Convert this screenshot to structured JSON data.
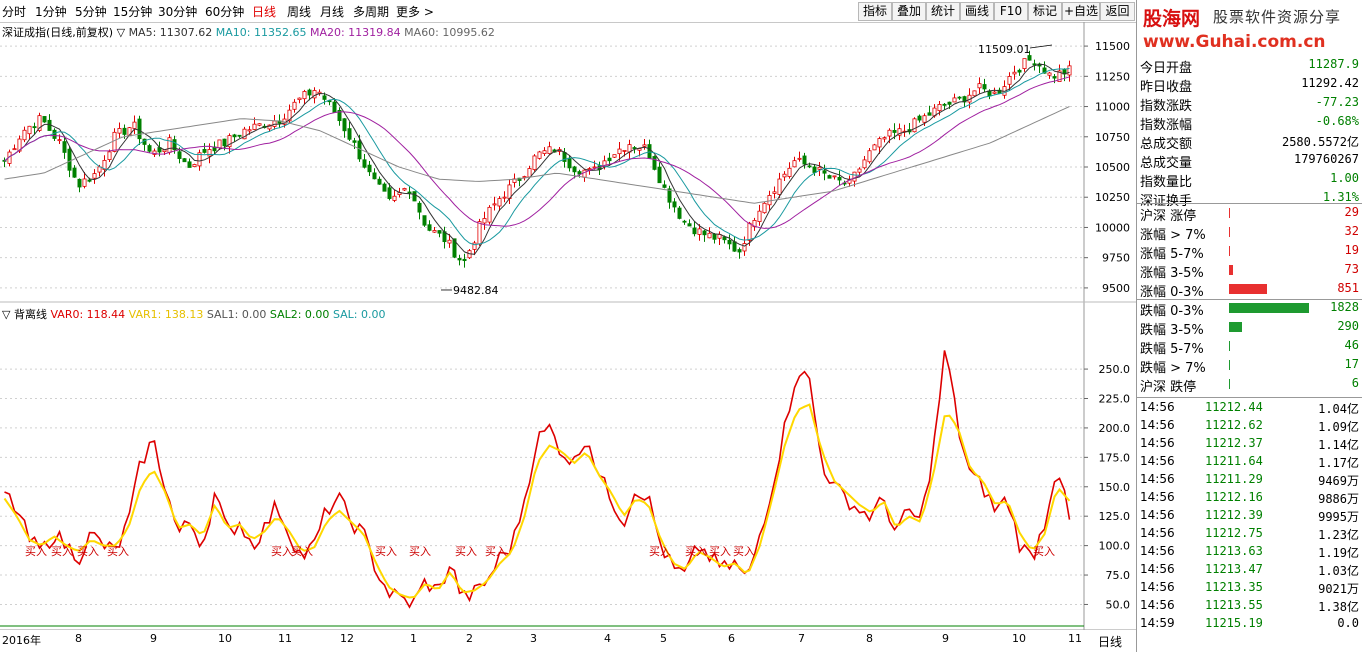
{
  "toolbar": {
    "periods": [
      "分时",
      "1分钟",
      "5分钟",
      "15分钟",
      "30分钟",
      "60分钟",
      "日线",
      "周线",
      "月线",
      "多周期",
      "更多 >"
    ],
    "active_period": "日线",
    "tools": [
      "指标",
      "叠加",
      "统计",
      "画线",
      "F10",
      "标记",
      "+自选",
      "返回"
    ]
  },
  "main_legend": {
    "name": "深证成指(日线,前复权)",
    "ma5": "MA5: 11307.62",
    "ma10": "MA10: 11352.65",
    "ma20": "MA20: 11319.84",
    "ma60": "MA60: 10995.62",
    "colors": {
      "ma5": "#333333",
      "ma10": "#1a9aa0",
      "ma20": "#a020a0",
      "ma60": "#777777"
    }
  },
  "main_axis": [
    "11500",
    "11250",
    "11000",
    "10750",
    "10500",
    "10250",
    "10000",
    "9750",
    "9500"
  ],
  "annotations": {
    "high": "11509.01",
    "low": "9482.84"
  },
  "indicator_legend": {
    "name": "背离线",
    "var0": "VAR0: 118.44",
    "var1": "VAR1: 138.13",
    "sal1": "SAL1: 0.00",
    "sal2": "SAL2: 0.00",
    "sal": "SAL: 0.00"
  },
  "indicator_axis": [
    "250.0",
    "225.0",
    "200.0",
    "175.0",
    "150.0",
    "125.0",
    "100.0",
    "75.0",
    "50.0"
  ],
  "buy_label": "买入",
  "months": [
    "2016年",
    "8",
    "9",
    "10",
    "11",
    "12",
    "1",
    "2",
    "3",
    "4",
    "5",
    "6",
    "7",
    "8",
    "9",
    "10",
    "11"
  ],
  "bottom_right": "日线",
  "banner": {
    "brand": "股海网",
    "slogan": "股票软件资源分享",
    "url": "www.Guhai.com.cn"
  },
  "stats": [
    {
      "label": "今日开盘",
      "value": "11287.9",
      "color": "green"
    },
    {
      "label": "昨日收盘",
      "value": "11292.42",
      "color": "black"
    },
    {
      "label": "指数涨跌",
      "value": "-77.23",
      "color": "green"
    },
    {
      "label": "指数涨幅",
      "value": "-0.68%",
      "color": "green"
    },
    {
      "label": "总成交额",
      "value": "2580.5572亿",
      "color": "black"
    },
    {
      "label": "总成交量",
      "value": "179760267",
      "color": "black"
    },
    {
      "label": "指数量比",
      "value": "1.00",
      "color": "green"
    },
    {
      "label": "深证换手",
      "value": "1.31%",
      "color": "green"
    }
  ],
  "breadth": [
    {
      "label": "沪深 涨停",
      "value": "29",
      "color": "red",
      "bar": 0
    },
    {
      "label": "涨幅 > 7%",
      "value": "32",
      "color": "red",
      "bar": 0
    },
    {
      "label": "涨幅 5-7%",
      "value": "19",
      "color": "red",
      "bar": 0
    },
    {
      "label": "涨幅 3-5%",
      "value": "73",
      "color": "red",
      "bar": 4
    },
    {
      "label": "涨幅 0-3%",
      "value": "851",
      "color": "red",
      "bar": 38
    },
    {
      "label": "跌幅 0-3%",
      "value": "1828",
      "color": "green",
      "bar": 80
    },
    {
      "label": "跌幅 3-5%",
      "value": "290",
      "color": "green",
      "bar": 13
    },
    {
      "label": "跌幅 5-7%",
      "value": "46",
      "color": "green",
      "bar": 0
    },
    {
      "label": "跌幅 > 7%",
      "value": "17",
      "color": "green",
      "bar": 0
    },
    {
      "label": "沪深 跌停",
      "value": "6",
      "color": "green",
      "bar": 0
    }
  ],
  "ticks": [
    {
      "time": "14:56",
      "price": "11212.44",
      "vol": "1.04亿"
    },
    {
      "time": "14:56",
      "price": "11212.62",
      "vol": "1.09亿"
    },
    {
      "time": "14:56",
      "price": "11212.37",
      "vol": "1.14亿"
    },
    {
      "time": "14:56",
      "price": "11211.64",
      "vol": "1.17亿"
    },
    {
      "time": "14:56",
      "price": "11211.29",
      "vol": "9469万"
    },
    {
      "time": "14:56",
      "price": "11212.16",
      "vol": "9886万"
    },
    {
      "time": "14:56",
      "price": "11212.39",
      "vol": "9995万"
    },
    {
      "time": "14:56",
      "price": "11212.75",
      "vol": "1.23亿"
    },
    {
      "time": "14:56",
      "price": "11213.63",
      "vol": "1.19亿"
    },
    {
      "time": "14:56",
      "price": "11213.47",
      "vol": "1.03亿"
    },
    {
      "time": "14:56",
      "price": "11213.35",
      "vol": "9021万"
    },
    {
      "time": "14:56",
      "price": "11213.55",
      "vol": "1.38亿"
    },
    {
      "time": "14:59",
      "price": "11215.19",
      "vol": "0.0"
    }
  ],
  "chart_data": {
    "type": "line",
    "main": {
      "name": "深证成指(日线,前复权)",
      "y_range": [
        9400,
        11600
      ],
      "x_months": [
        "2016年",
        "8",
        "9",
        "10",
        "11",
        "12",
        "1",
        "2",
        "3",
        "4",
        "5",
        "6",
        "7",
        "8",
        "9",
        "10",
        "11"
      ],
      "close_path": [
        10550,
        10800,
        10900,
        10700,
        10350,
        10450,
        10750,
        10850,
        10600,
        10700,
        10500,
        10650,
        10700,
        10800,
        10850,
        10900,
        11050,
        11150,
        10950,
        10700,
        10400,
        10200,
        10350,
        10000,
        9900,
        9700,
        10050,
        10250,
        10400,
        10600,
        10650,
        10500,
        10450,
        10600,
        10700,
        10650,
        10300,
        10050,
        9950,
        9900,
        9800,
        10150,
        10350,
        10550,
        10500,
        10400,
        10350,
        10600,
        10750,
        10800,
        10900,
        11000,
        11050,
        11150,
        11100,
        11300,
        11400,
        11250,
        11300
      ],
      "ma60_path": [
        10400,
        10450,
        10600,
        10750,
        10800,
        10850,
        10900,
        10880,
        10800,
        10650,
        10500,
        10400,
        10380,
        10400,
        10450,
        10400,
        10350,
        10300,
        10250,
        10200,
        10250,
        10300,
        10400,
        10500,
        10600,
        10700,
        10850,
        11000
      ],
      "high": 11509.01,
      "low": 9482.84
    },
    "indicator": {
      "name": "背离线",
      "y_range": [
        30,
        290
      ],
      "series": [
        {
          "name": "VAR0",
          "color": "#dd0000",
          "values": [
            145,
            130,
            105,
            95,
            110,
            100,
            90,
            110,
            100,
            95,
            120,
            170,
            190,
            150,
            110,
            120,
            100,
            145,
            110,
            120,
            100,
            115,
            135,
            110,
            90,
            100,
            130,
            140,
            120,
            110,
            80,
            60,
            55,
            50,
            70,
            60,
            85,
            55,
            60,
            70,
            90,
            100,
            140,
            190,
            200,
            180,
            170,
            195,
            160,
            140,
            120,
            150,
            140,
            100,
            80,
            75,
            100,
            90,
            80,
            85,
            70,
            110,
            150,
            200,
            250,
            240,
            170,
            150,
            140,
            130,
            125,
            140,
            110,
            130,
            120,
            180,
            270,
            200,
            160,
            150,
            130,
            140,
            100,
            90,
            120,
            170,
            120
          ]
        },
        {
          "name": "VAR1",
          "color": "#ffd800",
          "values": [
            140,
            125,
            105,
            100,
            108,
            100,
            95,
            105,
            100,
            100,
            115,
            150,
            165,
            145,
            115,
            118,
            108,
            135,
            115,
            118,
            105,
            112,
            125,
            112,
            95,
            98,
            120,
            130,
            120,
            110,
            85,
            65,
            58,
            55,
            68,
            62,
            78,
            60,
            62,
            70,
            85,
            95,
            125,
            170,
            185,
            180,
            170,
            180,
            160,
            145,
            125,
            140,
            135,
            105,
            85,
            80,
            95,
            90,
            82,
            85,
            75,
            100,
            140,
            185,
            215,
            220,
            180,
            155,
            145,
            135,
            128,
            138,
            115,
            125,
            120,
            160,
            215,
            200,
            165,
            155,
            135,
            138,
            110,
            95,
            110,
            150,
            138
          ]
        }
      ],
      "buy_signals": 19
    }
  }
}
